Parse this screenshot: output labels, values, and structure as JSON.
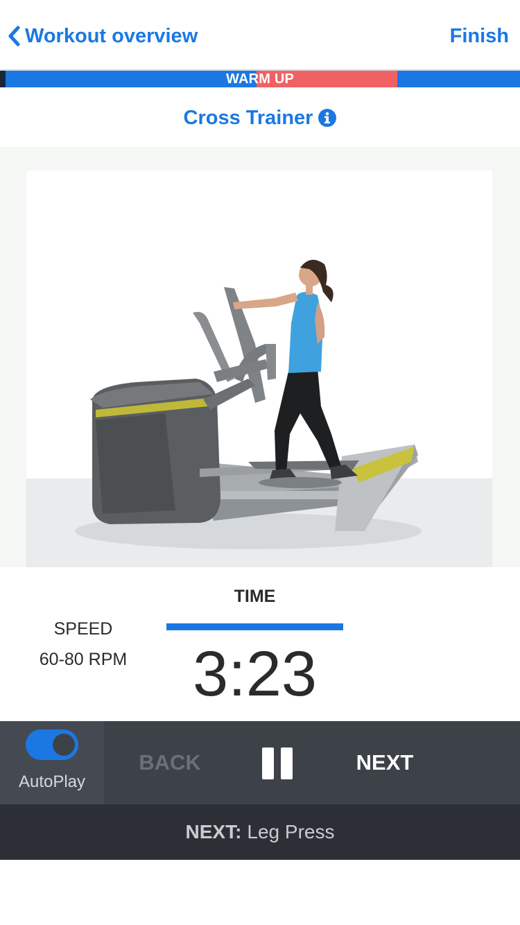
{
  "header": {
    "back_label": "Workout overview",
    "finish_label": "Finish"
  },
  "progress": {
    "stage_label": "WARM UP",
    "stage_fraction": 0.27,
    "colors": {
      "track": "#1b78e2",
      "fill": "#f06163",
      "marker": "#17263a"
    }
  },
  "exercise": {
    "name": "Cross Trainer",
    "info_icon": "info-circle-icon",
    "image": "woman-on-elliptical-cross-trainer"
  },
  "stats": {
    "speed_label": "SPEED",
    "speed_value": "60-80 RPM",
    "time_label": "TIME",
    "time_value": "3:23"
  },
  "controls": {
    "autoplay_label": "AutoPlay",
    "autoplay_on": true,
    "back_label": "BACK",
    "pause_icon": "pause-icon",
    "next_label": "NEXT"
  },
  "next_up": {
    "prefix": "NEXT:",
    "exercise": "Leg Press"
  },
  "colors": {
    "accent": "#1b78e2",
    "control_bar": "#3d4249",
    "next_bar": "#2c3036"
  }
}
